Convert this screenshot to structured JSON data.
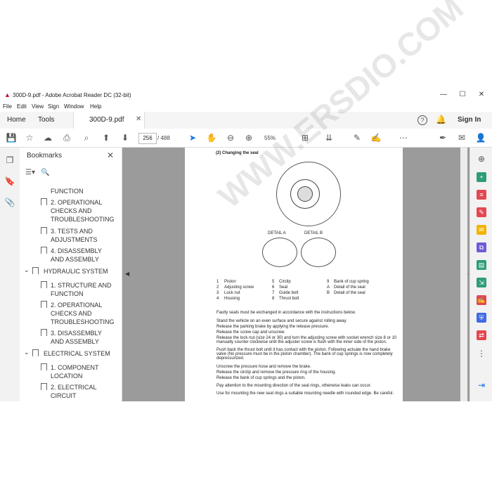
{
  "window": {
    "title": "300D-9.pdf - Adobe Acrobat Reader DC (32-bit)",
    "menu": [
      "File",
      "Edit",
      "View",
      "Sign",
      "Window",
      "Help"
    ],
    "tabs": {
      "home": "Home",
      "tools": "Tools",
      "doc": "300D-9.pdf"
    },
    "signin": "Sign In"
  },
  "toolbar": {
    "page": "256",
    "page_count": "/ 488",
    "zoom": "55%"
  },
  "bookmarks": {
    "title": "Bookmarks",
    "items": [
      {
        "label": "FUNCTION"
      },
      {
        "label": "2. OPERATIONAL CHECKS AND TROUBLESHOOTING"
      },
      {
        "label": "3. TESTS AND ADJUSTMENTS"
      },
      {
        "label": "4. DISASSEMBLY AND ASSEMBLY"
      },
      {
        "label": "HYDRAULIC SYSTEM"
      },
      {
        "label": "1. STRUCTURE AND FUNCTION"
      },
      {
        "label": "2. OPERATIONAL CHECKS AND TROUBLESHOOTING"
      },
      {
        "label": "3. DISASSEMBLY AND ASSEMBLY"
      },
      {
        "label": "ELECTRICAL SYSTEM"
      },
      {
        "label": "1. COMPONENT LOCATION"
      },
      {
        "label": "2. ELECTRICAL CIRCUIT"
      }
    ]
  },
  "document": {
    "heading": "(2) Changing the seal",
    "detail_a": "DETAIL A",
    "detail_b": "DETAIL B",
    "legend": [
      [
        "1",
        "Piston",
        "5",
        "Circlip",
        "9",
        "Bank of cup spring"
      ],
      [
        "2",
        "Adjusting screw",
        "6",
        "Seal",
        "A",
        "Detail of the seal"
      ],
      [
        "3",
        "Lock nut",
        "7",
        "Guide bolt",
        "B",
        "Detail of the seal"
      ],
      [
        "4",
        "Housing",
        "8",
        "Thrust bolt",
        "",
        ""
      ]
    ],
    "note": "Faulty seals must be exchanged in accordance with the instructions below.",
    "steps": [
      "Stand the vehicle on an even surface and secure against rolling away.",
      "Release the parking brake by applying the release pressure.",
      "Release the screw cap and unscrew.",
      "Release the lock nut (size 24 or 30) and turn the adjusting screw with socket wrench size 8 or 10 manually counter clockwise until the adjuster screw is flush with the inner side of the piston.",
      "Push back the thrust bolt until it has contact with the piston. Following actuate the hand brake valve (No pressure must be in the piston chamber). The bank of cup springs is now completely depressurized.",
      "Unscrew the pressure hose and remove the brake.",
      "Release the circlip and remove the pressure ring of the housing.",
      "Release the bank of cup springs and the piston."
    ],
    "warn1": "Pay attention to the mounting direction of the seal rings, otherwise leaks can occur.",
    "warn2": "Use for mounting the new seal rings a suitable mounting needle with rounded edge. Be careful."
  },
  "watermark": "WWW.ERSDIO.COM"
}
